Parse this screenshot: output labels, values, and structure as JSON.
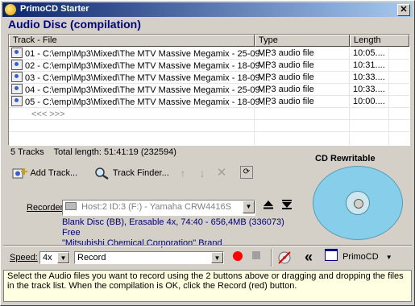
{
  "window": {
    "title": "PrimoCD Starter",
    "close_glyph": "✕"
  },
  "heading": "Audio Disc (compilation)",
  "columns": {
    "file": "Track - File",
    "type": "Type",
    "length": "Length"
  },
  "tracks": [
    {
      "file": "01 - C:\\emp\\Mp3\\Mixed\\The MTV Massive Megamix - 25-09-...",
      "type": "MP3 audio file",
      "length": "10:05...."
    },
    {
      "file": "02 - C:\\emp\\Mp3\\Mixed\\The MTV Massive Megamix - 18-09-...",
      "type": "MP3 audio file",
      "length": "10:31...."
    },
    {
      "file": "03 - C:\\emp\\Mp3\\Mixed\\The MTV Massive Megamix - 18-09-...",
      "type": "MP3 audio file",
      "length": "10:33...."
    },
    {
      "file": "04 - C:\\emp\\Mp3\\Mixed\\The MTV Massive Megamix - 25-09-...",
      "type": "MP3 audio file",
      "length": "10:33...."
    },
    {
      "file": "05 - C:\\emp\\Mp3\\Mixed\\The MTV Massive Megamix - 18-09-...",
      "type": "MP3 audio file",
      "length": "10:00...."
    }
  ],
  "list_placeholder": "<<< >>>",
  "summary": {
    "tracks": "5 Tracks",
    "total": "Total length: 51:41:19 (232594)"
  },
  "toolbar": {
    "add_track": "Add Track...",
    "track_finder": "Track Finder..."
  },
  "cd_label": "CD Rewritable",
  "recorder": {
    "label": "Recorder:",
    "value": "Host:2 ID:3 (F:) - Yamaha CRW4416S"
  },
  "disc_info": {
    "line1": "Blank Disc (BB), Erasable 4x, 74:40 - 656,4MB (336073) Free",
    "line2": "\"Mitsubishi Chemical Corporation\" Brand"
  },
  "speed": {
    "label": "Speed:",
    "value": "4x"
  },
  "mode": {
    "value": "Record"
  },
  "app_menu": "PrimoCD",
  "status_text": "Select the Audio files you want to record using the 2 buttons above or dragging and dropping the files in the track list. When the compilation is OK, click the Record (red) button.",
  "colors": {
    "title_start": "#0a246a",
    "heading": "#000080",
    "record": "#ff0000",
    "disc": "#87ceeb",
    "status_bg": "#ffffe1"
  }
}
